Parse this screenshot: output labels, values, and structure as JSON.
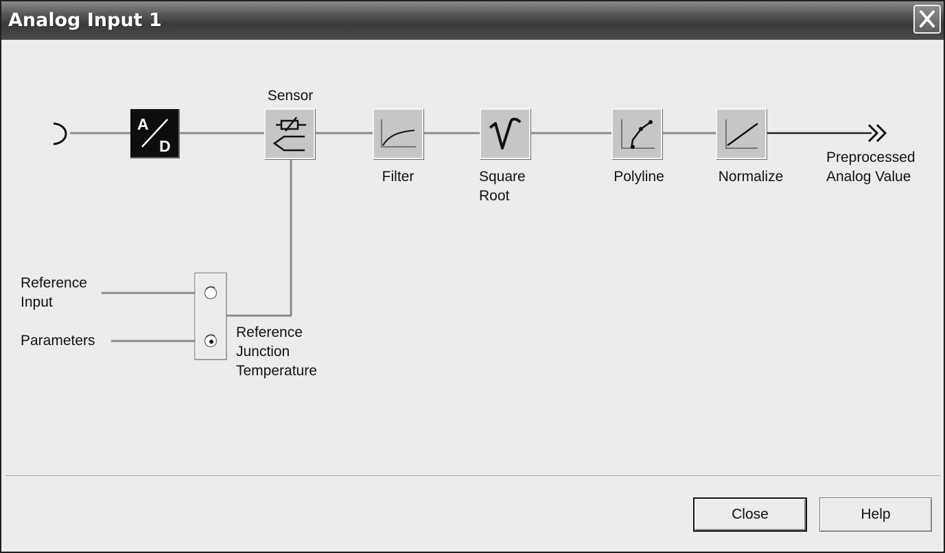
{
  "window": {
    "title": "Analog Input 1"
  },
  "diagram": {
    "blocks": {
      "ad_converter": {
        "top": "A",
        "bottom": "D"
      },
      "sensor": {
        "label": "Sensor"
      },
      "filter": {
        "label": "Filter"
      },
      "square_root": {
        "label_line1": "Square",
        "label_line2": "Root"
      },
      "polyline": {
        "label": "Polyline"
      },
      "normalize": {
        "label": "Normalize"
      }
    },
    "output": {
      "line1": "Preprocessed",
      "line2": "Analog Value"
    },
    "reference": {
      "option_input_line1": "Reference",
      "option_input_line2": "Input",
      "option_parameters": "Parameters",
      "selected": "Parameters",
      "junction_line1": "Reference",
      "junction_line2": "Junction",
      "junction_line3": "Temperature"
    }
  },
  "buttons": {
    "close_label": "Close",
    "help_label": "Help"
  },
  "colors": {
    "titlebar": "#4a4a4a",
    "client_bg": "#ececec",
    "block_fill": "#c6c6c6",
    "wire": "#8a8a8a"
  },
  "icons": [
    "input-connector-icon",
    "ad-converter-icon",
    "thermocouple-sensor-icon",
    "filter-curve-icon",
    "square-root-icon",
    "polyline-icon",
    "normalize-line-icon",
    "output-arrow-icon",
    "close-icon",
    "radio-icon"
  ]
}
